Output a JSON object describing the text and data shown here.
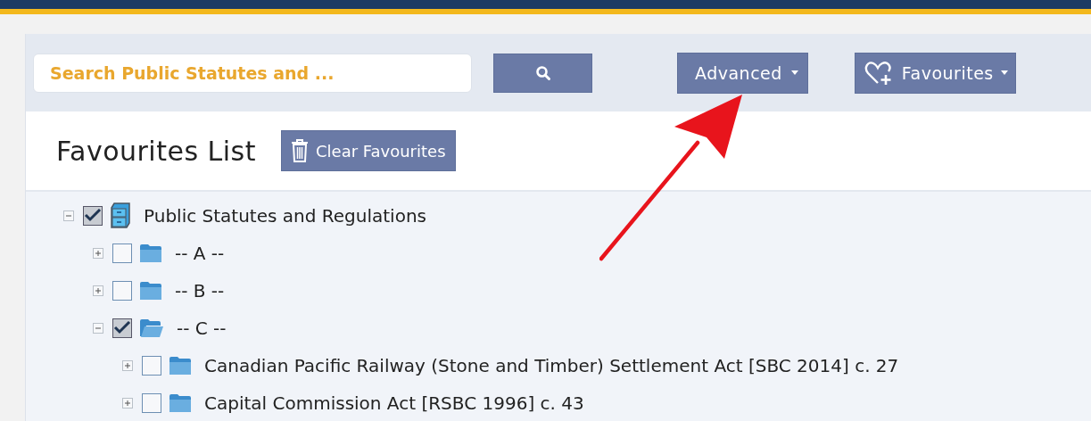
{
  "search": {
    "placeholder": "Search Public Statutes and ...",
    "advanced_label": "Advanced",
    "favourites_label": "Favourites"
  },
  "favourites_list": {
    "title": "Favourites List",
    "clear_label": "Clear Favourites"
  },
  "tree": [
    {
      "label": "Public Statutes and Regulations",
      "kind": "cabinet",
      "checked": true,
      "expanded": true,
      "children": [
        {
          "label": "-- A --",
          "kind": "folder",
          "checked": false,
          "expanded": false
        },
        {
          "label": "-- B --",
          "kind": "folder",
          "checked": false,
          "expanded": false
        },
        {
          "label": "-- C --",
          "kind": "folder",
          "checked": true,
          "expanded": true,
          "children": [
            {
              "label": "Canadian Pacific Railway (Stone and Timber) Settlement Act [SBC 2014] c. 27",
              "kind": "folder",
              "checked": false,
              "expanded": false
            },
            {
              "label": "Capital Commission Act [RSBC 1996] c. 43",
              "kind": "folder",
              "checked": false,
              "expanded": false
            }
          ]
        }
      ]
    }
  ]
}
